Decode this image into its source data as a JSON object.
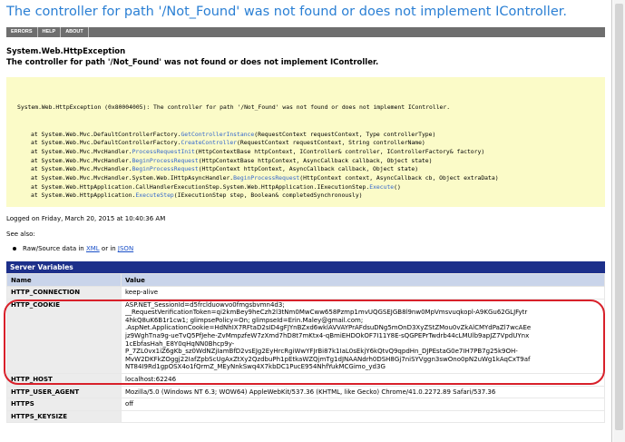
{
  "page": {
    "title": "The controller for path '/Not_Found' was not found or does not implement IController."
  },
  "toolbar": {
    "items": [
      "ERRORS",
      "HELP",
      "ABOUT"
    ]
  },
  "exception": {
    "type": "System.Web.HttpException",
    "message": "The controller for path '/Not_Found' was not found or does not implement IController."
  },
  "stack_trace": {
    "header": "System.Web.HttpException (0x80004005): The controller for path '/Not_Found' was not found or does not implement IController.",
    "frames": [
      {
        "pre": "at System.Web.Mvc.DefaultControllerFactory.",
        "method": "GetControllerInstance",
        "args": "(RequestContext requestContext, Type controllerType)"
      },
      {
        "pre": "at System.Web.Mvc.DefaultControllerFactory.",
        "method": "CreateController",
        "args": "(RequestContext requestContext, String controllerName)"
      },
      {
        "pre": "at System.Web.Mvc.MvcHandler.",
        "method": "ProcessRequestInit",
        "args": "(HttpContextBase httpContext, IController& controller, IControllerFactory& factory)"
      },
      {
        "pre": "at System.Web.Mvc.MvcHandler.",
        "method": "BeginProcessRequest",
        "args": "(HttpContextBase httpContext, AsyncCallback callback, Object state)"
      },
      {
        "pre": "at System.Web.Mvc.MvcHandler.",
        "method": "BeginProcessRequest",
        "args": "(HttpContext httpContext, AsyncCallback callback, Object state)"
      },
      {
        "pre": "at System.Web.Mvc.MvcHandler.System.Web.IHttpAsyncHandler.",
        "method": "BeginProcessRequest",
        "args": "(HttpContext context, AsyncCallback cb, Object extraData)"
      },
      {
        "pre": "at System.Web.HttpApplication.CallHandlerExecutionStep.System.Web.HttpApplication.IExecutionStep.",
        "method": "Execute",
        "args": "()"
      },
      {
        "pre": "at System.Web.HttpApplication.",
        "method": "ExecuteStep",
        "args": "(IExecutionStep step, Boolean& completedSynchronously)"
      }
    ]
  },
  "logged": "Logged on Friday, March 20, 2015 at 10:40:36 AM",
  "see_also": {
    "label": "See also:",
    "prefix": "Raw/Source data in ",
    "xml": "XML",
    "or": " or in ",
    "json": "JSON"
  },
  "server_variables": {
    "title": "Server Variables",
    "col_name": "Name",
    "col_value": "Value",
    "rows": [
      {
        "name": "HTTP_CONNECTION",
        "value": [
          "keep-alive"
        ]
      },
      {
        "name": "HTTP_COOKIE",
        "value": [
          "ASP.NET_SessionId=d5frclduowvo0fmgsbvmn4d3;",
          "__RequestVerificationToken=qi2kmBey9heCzh2l3tNm0MwCww658Pzmp1mvUQGSEJGB8l9nw0MpVmsvuqkopl-A9KGu62GLJFytr",
          "4hkQ8uK6B1r1cw1; glimpsePolicy=On; glimpseId=Erin.Maley@gmail.com;",
          ".AspNet.ApplicationCookie=HdNhIX7RFtaD2sID4gFJYnBZxd6wklAVVAYPrAFdsuDNg5mOnD3XyZStZMou0vZkAlCMYdPaZl7wcAEe",
          "jz9WghTna9g-ueTvQ5PfJehe-ZvMmpzfeW7zXmd7hD8t7mKtx4-qBmiEHDOkOF7I11Y8E-sQGPEPrTwdrb44cLMUlb9apJZ7VpdUYnx",
          "1cEbfasHah_E8Y0qHqNN0Bhcp9y-",
          "P_7ZL0vx1iZ6gKb_sz0WdNZjIamBfD2vsEJg2EyHrcRgiWwYFJrBi87k1IaL0sEkjY6kQtvQ9qpdHn_DJPEstaG0e7IH7PB7g25k9OH-",
          "MvW2DKFkZOggj22IafZpbScUgAxZtXy2QzdbuPh1pEtkaWZQjmTg1dJNAANdrh0DSH8Gj7niSYVggn3swOno0pN2uWg1kAqCxT9af",
          "NT84I9Rd1gpOSX4o1fQrmZ_MEyNnkSwq4X7kbDC1PucE954NhfYukMCGimo_yd3G"
        ]
      },
      {
        "name": "HTTP_HOST",
        "value": [
          "localhost:62246"
        ]
      },
      {
        "name": "HTTP_USER_AGENT",
        "value": [
          "Mozilla/5.0 (Windows NT 6.3; WOW64) AppleWebKit/537.36 (KHTML, like Gecko) Chrome/41.0.2272.89 Safari/537.36"
        ]
      },
      {
        "name": "HTTPS",
        "value": [
          "off"
        ]
      },
      {
        "name": "HTTPS_KEYSIZE",
        "value": [
          ""
        ]
      }
    ]
  },
  "colors": {
    "title_blue": "#2a7fd4",
    "toolbar_gray": "#6e6e6e",
    "trace_bg": "#fbfbc8",
    "header_navy": "#1c2f8a",
    "highlight_red": "#d8202a"
  }
}
